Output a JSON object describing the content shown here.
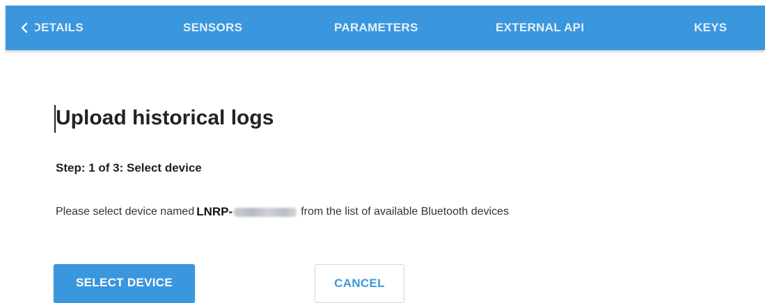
{
  "tabs": {
    "partial_label": "DETAILS",
    "items": [
      "SENSORS",
      "PARAMETERS",
      "EXTERNAL API",
      "KEYS"
    ],
    "back_icon": "chevron-left-icon",
    "color": "#3a96dd"
  },
  "page": {
    "title": "Upload historical logs",
    "step": "Step: 1 of 3: Select device",
    "instruction_prefix": "Please select device named",
    "device_name_prefix": "LNRP-",
    "instruction_suffix": "from the list of available Bluetooth devices"
  },
  "actions": {
    "select_device_label": "SELECT DEVICE",
    "cancel_label": "CANCEL"
  }
}
